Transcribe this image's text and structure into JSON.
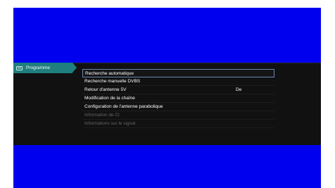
{
  "tab": {
    "label": "Programme",
    "icon": "tv-icon"
  },
  "menu": {
    "items": [
      {
        "label": "Recherche automatique",
        "value": "",
        "selected": true,
        "enabled": true
      },
      {
        "label": "Recherche manuelle DVBS",
        "value": "",
        "selected": false,
        "enabled": true
      },
      {
        "label": "Retour d'antenne 5V",
        "value": "De",
        "selected": false,
        "enabled": true
      },
      {
        "label": "Modification de la chaîne",
        "value": "",
        "selected": false,
        "enabled": true
      },
      {
        "label": "Configuration de l'antenne parabolique",
        "value": "",
        "selected": false,
        "enabled": true
      },
      {
        "label": "Information de CI",
        "value": "",
        "selected": false,
        "enabled": false
      },
      {
        "label": "Informations sur le signal",
        "value": "",
        "selected": false,
        "enabled": false
      }
    ]
  },
  "colors": {
    "background": "#0000ee",
    "panel": "#111111",
    "tab": "#1f7f7e",
    "selection_border": "#6a86b6",
    "disabled_text": "#666666"
  }
}
